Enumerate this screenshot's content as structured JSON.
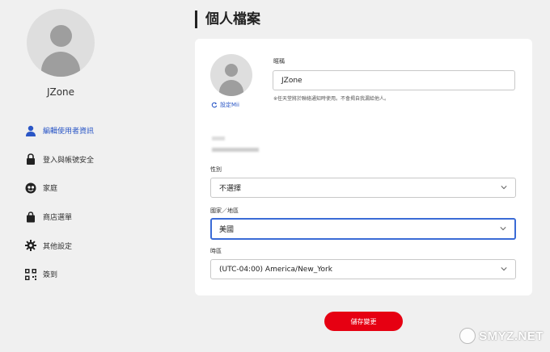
{
  "sidebar": {
    "username": "JZone",
    "items": [
      {
        "label": "編輯使用者資訊",
        "icon": "person-icon",
        "active": true
      },
      {
        "label": "登入與帳號安全",
        "icon": "lock-icon"
      },
      {
        "label": "家庭",
        "icon": "family-icon"
      },
      {
        "label": "商店選單",
        "icon": "shopping-bag-icon"
      },
      {
        "label": "其他設定",
        "icon": "gear-icon"
      },
      {
        "label": "簽到",
        "icon": "qr-code-icon"
      }
    ]
  },
  "page": {
    "title": "個人檔案"
  },
  "profile": {
    "mii_link": "設定Mii",
    "nickname_label": "暱稱",
    "nickname_value": "JZone",
    "nickname_hint": "※任天堂將於聯絡通知時使用。不會揭自我漏給他人。",
    "gender_label": "性別",
    "gender_value": "不選擇",
    "country_label": "國家／地區",
    "country_value": "美國",
    "timezone_label": "時區",
    "timezone_value": "(UTC-04:00) America/New_York"
  },
  "actions": {
    "save_label": "儲存變更"
  },
  "watermark": {
    "text": "SMYZ.NET"
  },
  "colors": {
    "accent": "#2a56c6",
    "save_button": "#e60012"
  }
}
